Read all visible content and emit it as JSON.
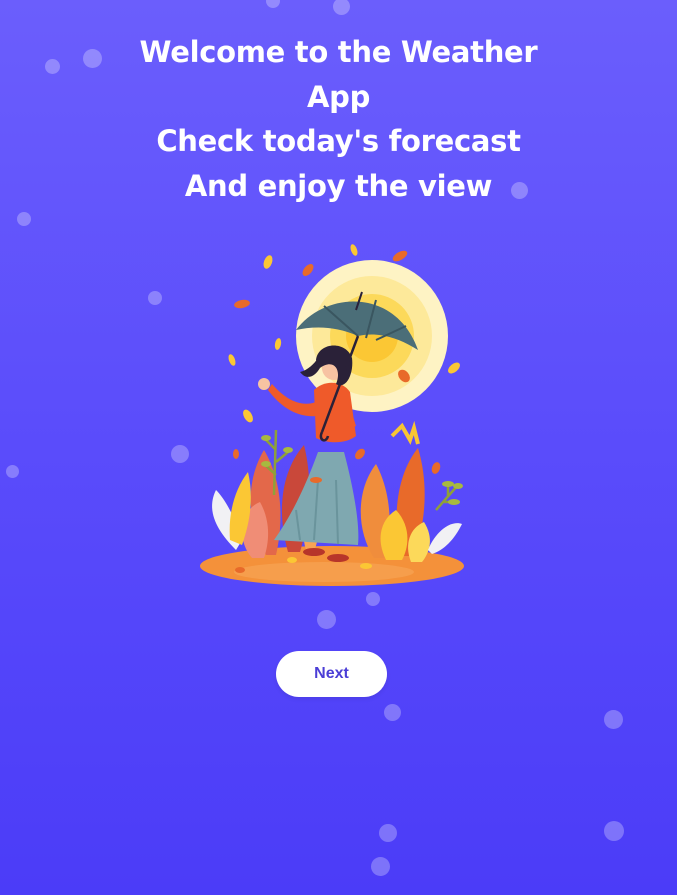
{
  "welcome": {
    "lines": [
      "Welcome to the Weather",
      "App",
      "Check today's forecast",
      "And enjoy the view"
    ]
  },
  "illustration": {
    "icon": "woman-with-umbrella-autumn-illustration"
  },
  "actions": {
    "next_label": "Next"
  },
  "colors": {
    "background_top": "#6b5efc",
    "background_bottom": "#4b3cf8",
    "button_background": "#ffffff",
    "button_text": "#4b3ed6"
  }
}
